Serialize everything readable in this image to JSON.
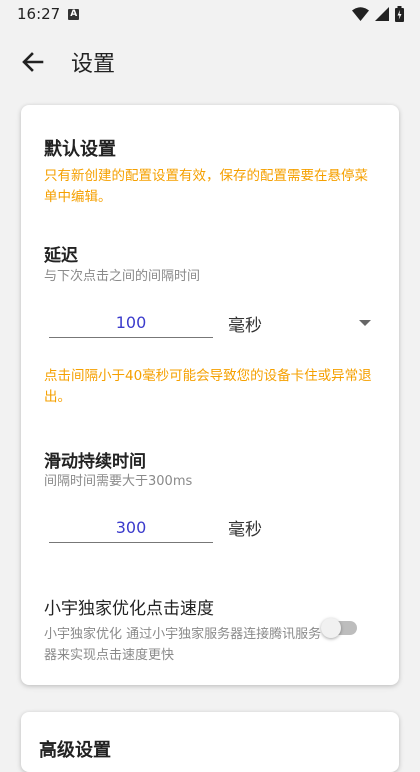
{
  "status_bar": {
    "time": "16:27",
    "notification_badge": "A",
    "icons": [
      "wifi-icon",
      "signal-icon",
      "battery-icon"
    ]
  },
  "app_bar": {
    "back_icon": "arrow-left-icon",
    "title": "设置"
  },
  "default_settings": {
    "title": "默认设置",
    "warning": "只有新创建的配置设置有效，保存的配置需要在悬停菜单中编辑。",
    "delay": {
      "label": "延迟",
      "hint": "与下次点击之间的间隔时间",
      "value": "100",
      "unit": "毫秒",
      "warning": "点击间隔小于40毫秒可能会导致您的设备卡住或异常退出。"
    },
    "swipe_duration": {
      "label": "滑动持续时间",
      "hint": "间隔时间需要大于300ms",
      "value": "300",
      "unit": "毫秒"
    },
    "optimize": {
      "label": "小宇独家优化点击速度",
      "hint": "小宇独家优化  通过小宇独家服务器连接腾讯服务器来实现点击速度更快",
      "enabled": false
    }
  },
  "advanced_settings": {
    "title": "高级设置"
  },
  "colors": {
    "warning": "#f5a000",
    "input_text": "#3b3bcc",
    "hint": "#8a8a8a"
  }
}
